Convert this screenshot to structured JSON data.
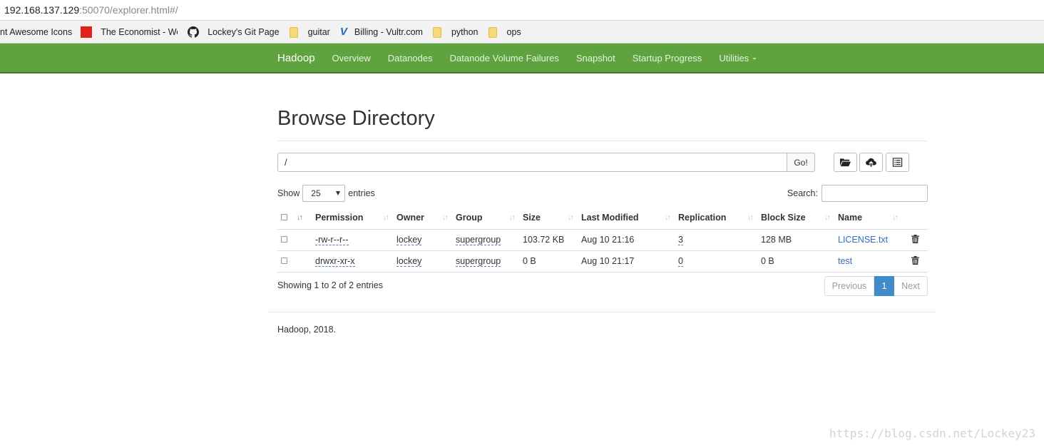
{
  "browser": {
    "url_host": "192.168.137.129",
    "url_rest": ":50070/explorer.html#/",
    "bookmarks": [
      {
        "label": "nt Awesome Icons",
        "icon": "none"
      },
      {
        "label": "The Economist - Wo",
        "icon": "economist-icon"
      },
      {
        "label": "Lockey's Git Page",
        "icon": "github-icon"
      },
      {
        "label": "guitar",
        "icon": "folder-icon"
      },
      {
        "label": "Billing - Vultr.com",
        "icon": "vultr-icon"
      },
      {
        "label": "python",
        "icon": "folder-icon"
      },
      {
        "label": "ops",
        "icon": "folder-icon"
      }
    ]
  },
  "navbar": {
    "brand": "Hadoop",
    "items": [
      "Overview",
      "Datanodes",
      "Datanode Volume Failures",
      "Snapshot",
      "Startup Progress",
      "Utilities"
    ]
  },
  "page": {
    "title": "Browse Directory",
    "path_value": "/",
    "go_label": "Go!",
    "show_label": "Show",
    "entries_value": "25",
    "entries_label": "entries",
    "search_label": "Search:",
    "search_value": ""
  },
  "table": {
    "headers": [
      "Permission",
      "Owner",
      "Group",
      "Size",
      "Last Modified",
      "Replication",
      "Block Size",
      "Name"
    ],
    "rows": [
      {
        "permission": "-rw-r--r--",
        "owner": "lockey",
        "group": "supergroup",
        "size": "103.72 KB",
        "modified": "Aug 10 21:16",
        "replication": "3",
        "block_size": "128 MB",
        "name": "LICENSE.txt"
      },
      {
        "permission": "drwxr-xr-x",
        "owner": "lockey",
        "group": "supergroup",
        "size": "0 B",
        "modified": "Aug 10 21:17",
        "replication": "0",
        "block_size": "0 B",
        "name": "test"
      }
    ]
  },
  "pagination": {
    "info": "Showing 1 to 2 of 2 entries",
    "previous": "Previous",
    "current": "1",
    "next": "Next"
  },
  "footer": "Hadoop, 2018.",
  "watermark": "https://blog.csdn.net/Lockey23",
  "colors": {
    "navbar": "#5fa33e",
    "link": "#2f6fb6",
    "page_active": "#428bca"
  }
}
